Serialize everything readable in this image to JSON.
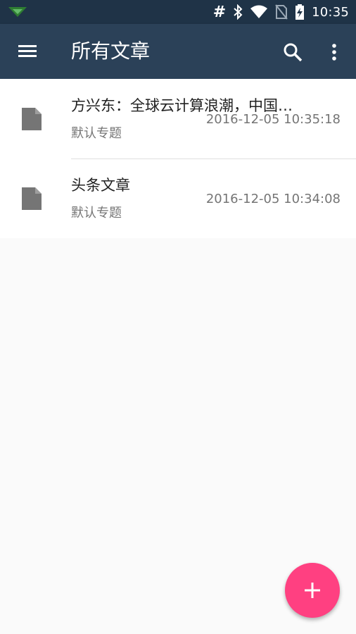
{
  "status_bar": {
    "time": "10:35",
    "hash_symbol": "#",
    "icons": [
      "app-notification-icon",
      "hash-icon",
      "bluetooth-icon",
      "wifi-icon",
      "no-sim-icon",
      "battery-charging-icon"
    ]
  },
  "app_bar": {
    "title": "所有文章",
    "icons": [
      "menu-icon",
      "search-icon",
      "more-vert-icon"
    ]
  },
  "articles": [
    {
      "title": "方兴东：全球云计算浪潮，中国…",
      "category": "默认专题",
      "date": "2016-12-05 10:35:18"
    },
    {
      "title": "头条文章",
      "category": "默认专题",
      "date": "2016-12-05 10:34:08"
    }
  ],
  "fab": {
    "icon": "add-icon"
  },
  "colors": {
    "status_bar": "#1f3347",
    "app_bar": "#2b4158",
    "fab": "#ff4081",
    "doc_icon": "#757575",
    "background": "#fafafa"
  }
}
